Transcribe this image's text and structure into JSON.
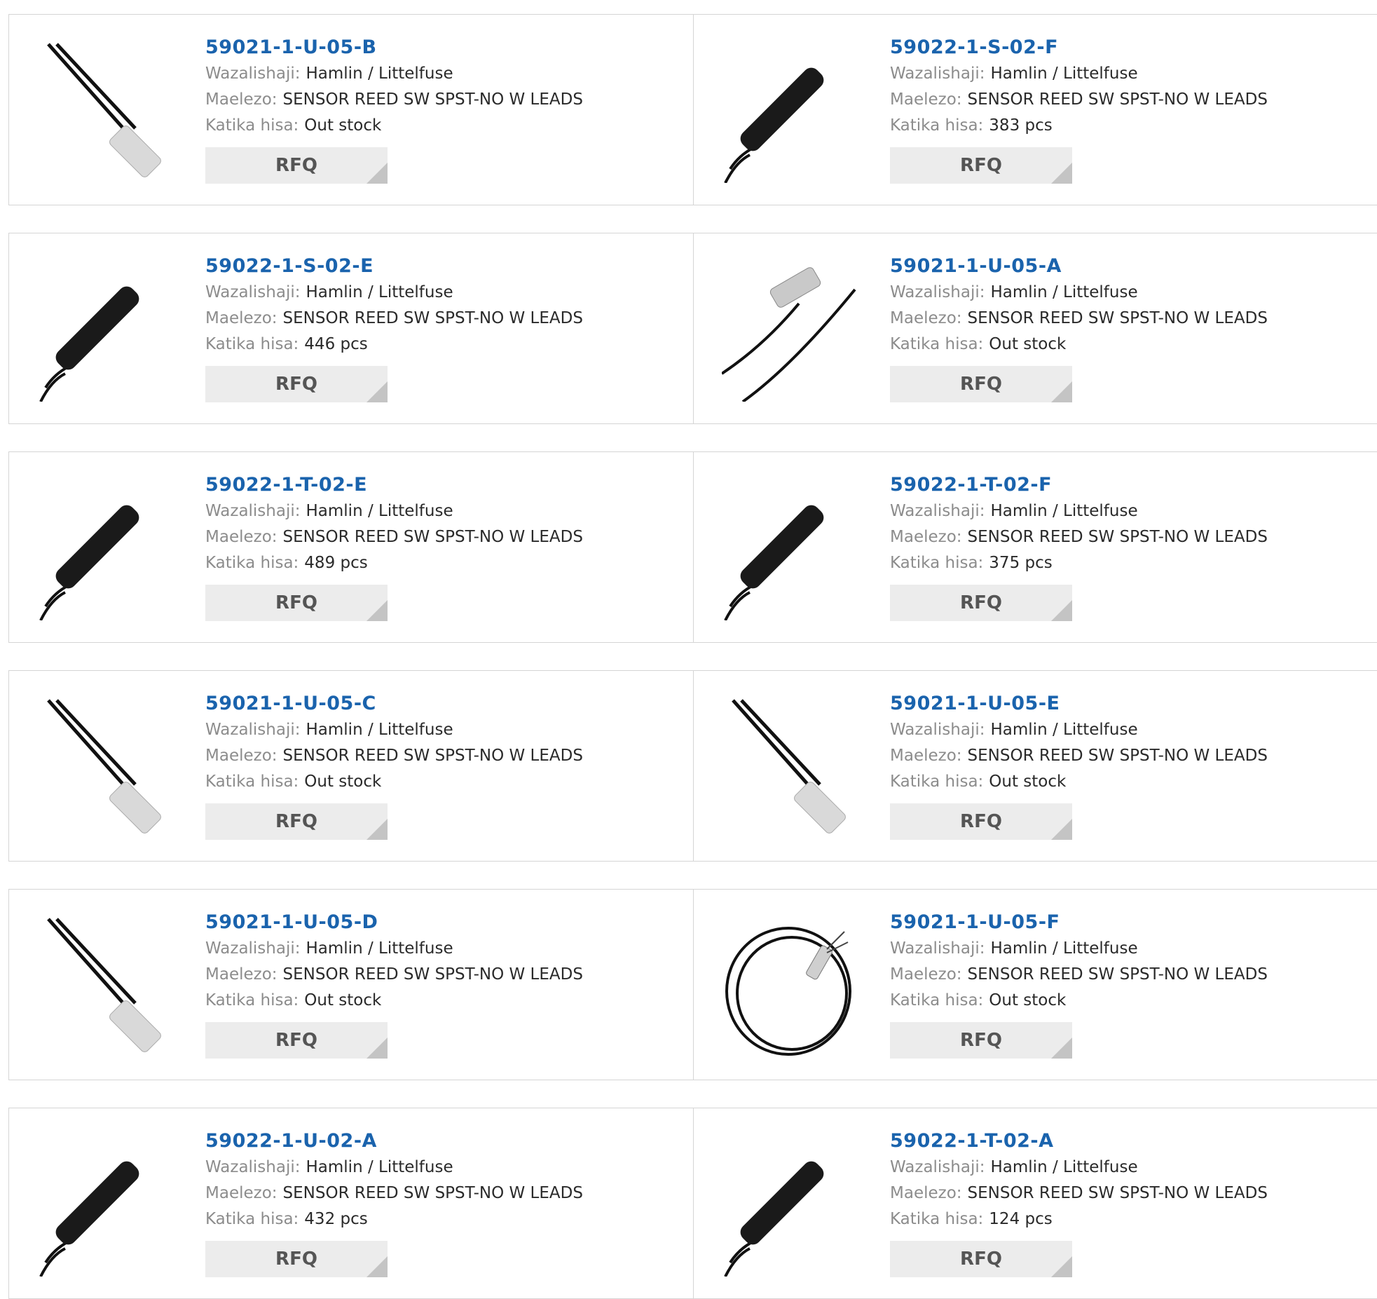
{
  "labels": {
    "manufacturer": "Wazalishaji:",
    "description": "Maelezo:",
    "stock": "Katika hisa:",
    "rfq": "RFQ"
  },
  "products": [
    {
      "part": "59021-1-U-05-B",
      "manufacturer": "Hamlin / Littelfuse",
      "description": "SENSOR REED SW SPST-NO W LEADS",
      "stock": "Out stock",
      "image": "silver-sensor-icon"
    },
    {
      "part": "59022-1-S-02-F",
      "manufacturer": "Hamlin / Littelfuse",
      "description": "SENSOR REED SW SPST-NO W LEADS",
      "stock": "383 pcs",
      "image": "black-sensor-icon"
    },
    {
      "part": "59022-1-S-02-E",
      "manufacturer": "Hamlin / Littelfuse",
      "description": "SENSOR REED SW SPST-NO W LEADS",
      "stock": "446 pcs",
      "image": "black-sensor-icon"
    },
    {
      "part": "59021-1-U-05-A",
      "manufacturer": "Hamlin / Littelfuse",
      "description": "SENSOR REED SW SPST-NO W LEADS",
      "stock": "Out stock",
      "image": "silver-sensor-leads-icon"
    },
    {
      "part": "59022-1-T-02-E",
      "manufacturer": "Hamlin / Littelfuse",
      "description": "SENSOR REED SW SPST-NO W LEADS",
      "stock": "489 pcs",
      "image": "black-sensor-icon"
    },
    {
      "part": "59022-1-T-02-F",
      "manufacturer": "Hamlin / Littelfuse",
      "description": "SENSOR REED SW SPST-NO W LEADS",
      "stock": "375 pcs",
      "image": "black-sensor-icon"
    },
    {
      "part": "59021-1-U-05-C",
      "manufacturer": "Hamlin / Littelfuse",
      "description": "SENSOR REED SW SPST-NO W LEADS",
      "stock": "Out stock",
      "image": "silver-sensor-icon"
    },
    {
      "part": "59021-1-U-05-E",
      "manufacturer": "Hamlin / Littelfuse",
      "description": "SENSOR REED SW SPST-NO W LEADS",
      "stock": "Out stock",
      "image": "silver-sensor-icon"
    },
    {
      "part": "59021-1-U-05-D",
      "manufacturer": "Hamlin / Littelfuse",
      "description": "SENSOR REED SW SPST-NO W LEADS",
      "stock": "Out stock",
      "image": "silver-sensor-icon"
    },
    {
      "part": "59021-1-U-05-F",
      "manufacturer": "Hamlin / Littelfuse",
      "description": "SENSOR REED SW SPST-NO W LEADS",
      "stock": "Out stock",
      "image": "coiled-sensor-icon"
    },
    {
      "part": "59022-1-U-02-A",
      "manufacturer": "Hamlin / Littelfuse",
      "description": "SENSOR REED SW SPST-NO W LEADS",
      "stock": "432 pcs",
      "image": "black-sensor-icon"
    },
    {
      "part": "59022-1-T-02-A",
      "manufacturer": "Hamlin / Littelfuse",
      "description": "SENSOR REED SW SPST-NO W LEADS",
      "stock": "124 pcs",
      "image": "black-sensor-icon"
    }
  ],
  "colors": {
    "link": "#1a63ad",
    "label": "#8c8c8c",
    "border": "#d5d5d5",
    "button": "#ececec"
  }
}
